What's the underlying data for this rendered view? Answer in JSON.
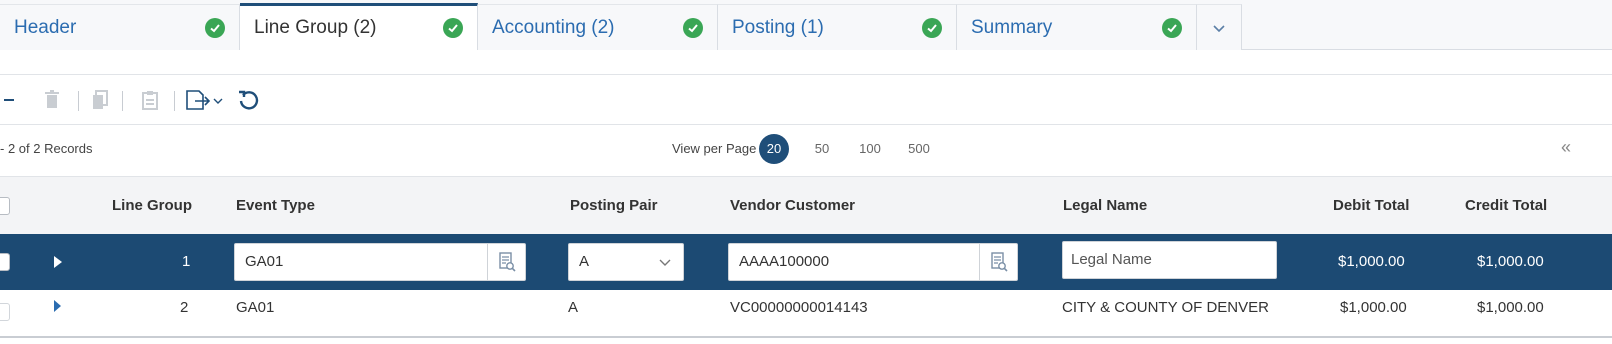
{
  "tabs": [
    {
      "label": "Header",
      "complete": true
    },
    {
      "label": "Line Group (2)",
      "complete": true,
      "active": true
    },
    {
      "label": "Accounting (2)",
      "complete": true
    },
    {
      "label": "Posting (1)",
      "complete": true
    },
    {
      "label": "Summary",
      "complete": true
    }
  ],
  "toolbar": {
    "icons": [
      "minus-icon",
      "delete-icon",
      "copy-icon",
      "paste-icon",
      "export-icon",
      "refresh-icon"
    ]
  },
  "records": {
    "count_text": "- 2 of 2 Records",
    "view_per_page_label": "View per Page -",
    "page_sizes": [
      "20",
      "50",
      "100",
      "500"
    ],
    "selected_page_size": "20",
    "collapse_glyph": "«"
  },
  "grid": {
    "columns": [
      "Line Group",
      "Event Type",
      "Posting Pair",
      "Vendor Customer",
      "Legal Name",
      "Debit Total",
      "Credit Total"
    ],
    "rows": [
      {
        "line_group": "1",
        "event_type": "GA01",
        "posting_pair": "A",
        "vendor_customer": "AAAA100000",
        "legal_name_placeholder": "Legal Name",
        "debit_total": "$1,000.00",
        "credit_total": "$1,000.00",
        "selected": true
      },
      {
        "line_group": "2",
        "event_type": "GA01",
        "posting_pair": "A",
        "vendor_customer": "VC00000000014143",
        "legal_name": "CITY & COUNTY OF DENVER",
        "debit_total": "$1,000.00",
        "credit_total": "$1,000.00",
        "selected": false
      }
    ]
  },
  "colors": {
    "accent": "#1f4e79",
    "selected_row": "#1c4a73",
    "success": "#3aa655",
    "link": "#2b6cb0"
  }
}
